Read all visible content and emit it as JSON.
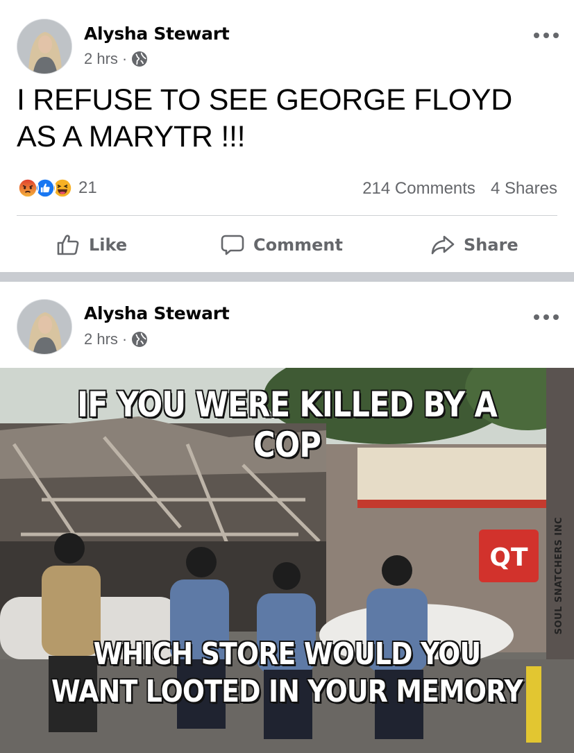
{
  "colors": {
    "text_primary": "#050505",
    "text_secondary": "#65676b",
    "divider": "#c9ccd1",
    "like_blue": "#1877f2",
    "angry": "#e9710f",
    "haha": "#f7b125"
  },
  "posts": [
    {
      "author": "Alysha Stewart",
      "time": "2 hrs",
      "separator": "·",
      "privacy_icon": "globe-icon",
      "text_lines": [
        "I REFUSE TO SEE GEORGE FLOYD",
        "AS A MARYTR !!!"
      ],
      "reactions": {
        "icons": [
          "angry-reaction-icon",
          "like-reaction-icon",
          "haha-reaction-icon"
        ],
        "count": "21"
      },
      "comments_label": "214 Comments",
      "shares_label": "4 Shares",
      "actions": {
        "like": "Like",
        "comment": "Comment",
        "share": "Share"
      }
    },
    {
      "author": "Alysha Stewart",
      "time": "2 hrs",
      "separator": "·",
      "privacy_icon": "globe-icon",
      "meme": {
        "top_text": "IF YOU WERE KILLED BY A COP",
        "bottom_line1": "WHICH STORE WOULD YOU",
        "bottom_line2": "WANT LOOTED IN YOUR MEMORY",
        "store_sign": "QT",
        "watermark": "SOUL SNATCHERS INC"
      }
    }
  ]
}
